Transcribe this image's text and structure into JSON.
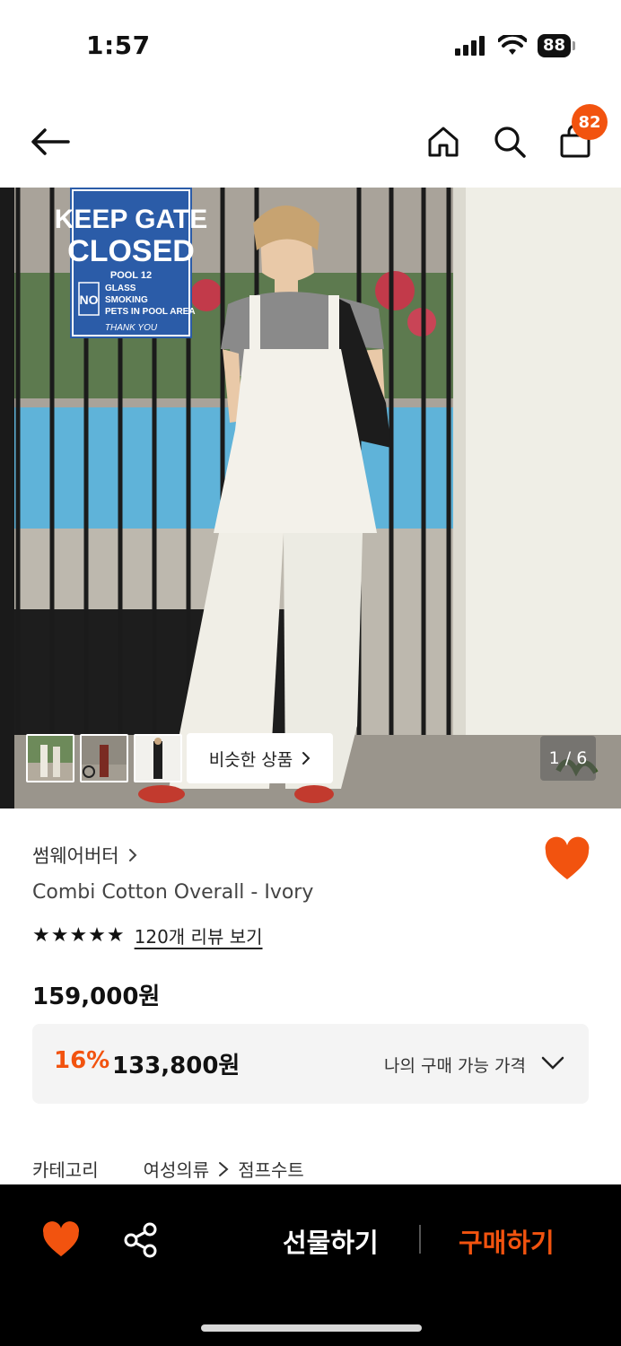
{
  "status": {
    "time": "1:57",
    "battery": "88"
  },
  "header": {
    "cart_count": "82"
  },
  "hero": {
    "sign_line1": "KEEP GATE",
    "sign_line2": "CLOSED",
    "sign_pool": "POOL 12",
    "sign_no": "NO",
    "sign_item1": "GLASS",
    "sign_item2": "SMOKING",
    "sign_item3": "PETS IN POOL AREA",
    "sign_thanks": "THANK YOU",
    "similar_label": "비슷한 상품",
    "image_counter": "1 / 6"
  },
  "product": {
    "brand": "썸웨어버터",
    "name": "Combi Cotton Overall - Ivory",
    "stars": "★★★★★",
    "review_link": "120개 리뷰 보기",
    "price": "159,000원",
    "discount_rate": "16%",
    "discount_price": "133,800원",
    "my_price_label": "나의 구매 가능 가격"
  },
  "category": {
    "label": "카테고리",
    "level1": "여성의류",
    "level2": "점프수트"
  },
  "bottom_bar": {
    "gift_label": "선물하기",
    "buy_label": "구매하기"
  },
  "colors": {
    "accent": "#f2530f",
    "bar_bg": "#000000",
    "sign_blue": "#2b5ca8"
  },
  "icons": [
    "arrow-left-icon",
    "home-icon",
    "search-icon",
    "shopping-bag-icon",
    "heart-icon",
    "share-icon",
    "chevron-right-icon",
    "chevron-down-icon"
  ]
}
